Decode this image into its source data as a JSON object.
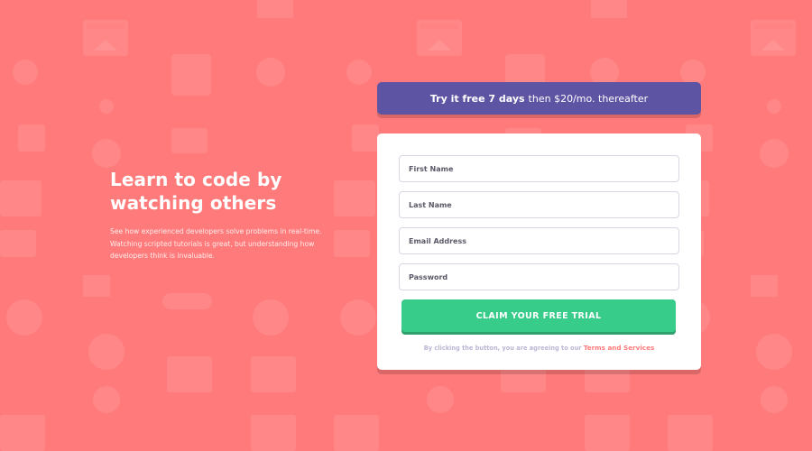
{
  "hero": {
    "heading_line1": "Learn to code by",
    "heading_line2": "watching others",
    "description": "See how experienced developers solve problems in real-time. Watching scripted tutorials is great, but understanding how developers think is invaluable."
  },
  "promo": {
    "bold_text": "Try it free 7 days",
    "rest_text": "then $20/mo. thereafter"
  },
  "form": {
    "first_name_placeholder": "First Name",
    "last_name_placeholder": "Last Name",
    "email_placeholder": "Email Address",
    "password_placeholder": "Password",
    "submit_label": "CLAIM YOUR FREE TRIAL",
    "terms_prefix": "By clicking the button, you are agreeing to our",
    "terms_link": "Terms and Services"
  },
  "colors": {
    "background": "#ff7a7a",
    "promo": "#5e54a4",
    "submit": "#38cc8b",
    "terms_link": "#ff7a7a"
  }
}
